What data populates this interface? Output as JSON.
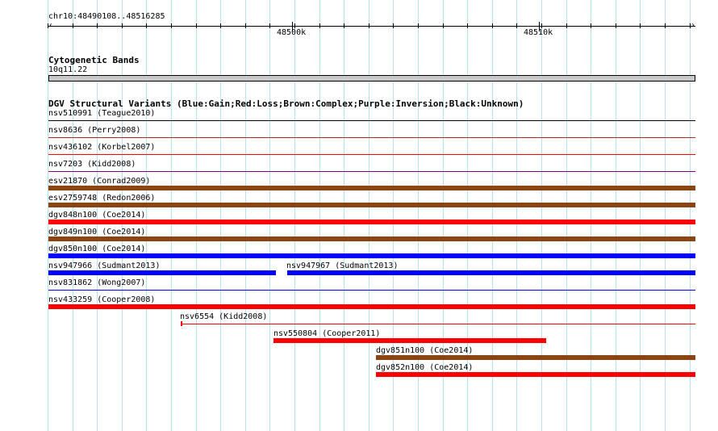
{
  "ruler": {
    "location": "chr10:48490108..48516285",
    "ticks": [
      "48500k",
      "48510k"
    ]
  },
  "cytoband_track": {
    "title": "Cytogenetic Bands",
    "band": "10q11.22"
  },
  "dgv_track": {
    "title": "DGV Structural Variants (Blue:Gain;Red:Loss;Brown:Complex;Purple:Inversion;Black:Unknown)",
    "colors": {
      "gain": "#0000ff",
      "loss": "#ff0000",
      "complex": "#8b4513",
      "inversion": "#800080",
      "unknown": "#000000",
      "loss_thin": "#a52a2a"
    },
    "features": [
      {
        "label": "nsv510991 (Teague2010)"
      },
      {
        "label": "nsv8636 (Perry2008)"
      },
      {
        "label": "nsv436102 (Korbel2007)"
      },
      {
        "label": "nsv7203 (Kidd2008)"
      },
      {
        "label": "esv21870 (Conrad2009)"
      },
      {
        "label": "esv2759748 (Redon2006)"
      },
      {
        "label": "dgv848n100 (Coe2014)"
      },
      {
        "label": "dgv849n100 (Coe2014)"
      },
      {
        "label": "dgv850n100 (Coe2014)"
      },
      {
        "label": "nsv947966 (Sudmant2013)"
      },
      {
        "label": "nsv947967 (Sudmant2013)"
      },
      {
        "label": "nsv831862 (Wong2007)"
      },
      {
        "label": "nsv433259 (Cooper2008)"
      },
      {
        "label": "nsv6554 (Kidd2008)"
      },
      {
        "label": "nsv550804 (Cooper2011)"
      },
      {
        "label": "dgv851n100 (Coe2014)"
      },
      {
        "label": "dgv852n100 (Coe2014)"
      }
    ]
  }
}
